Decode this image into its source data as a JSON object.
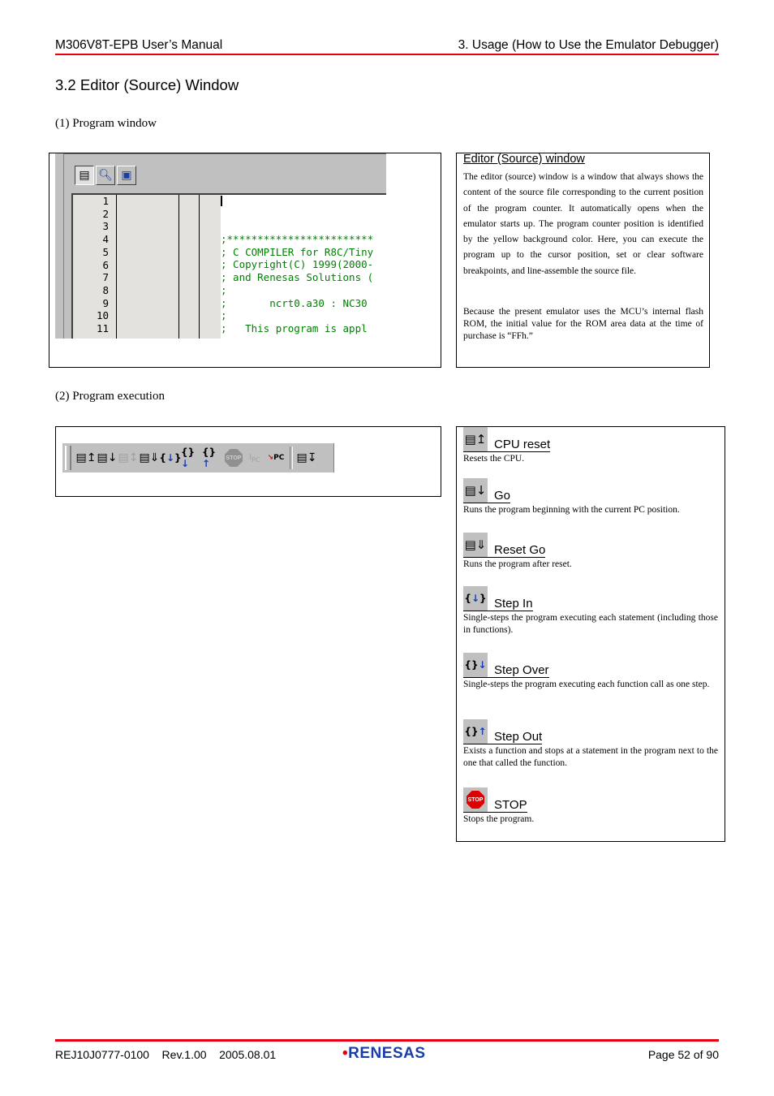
{
  "header": {
    "left": "M306V8T-EPB User’s Manual",
    "right": "3. Usage (How to Use the Emulator Debugger)"
  },
  "section_title": "3.2 Editor (Source) Window",
  "program_window": {
    "subtitle": "(1) Program window",
    "toolbar_icons": [
      "source-view-icon",
      "source-search-icon",
      "mixed-view-icon"
    ],
    "line_numbers": [
      "1",
      "2",
      "3",
      "4",
      "5",
      "6",
      "7",
      "8",
      "9",
      "10",
      "11"
    ],
    "source_lines": [
      ";************************",
      "; C COMPILER for R8C/Tiny",
      "; Copyright(C) 1999(2000-",
      "; and Renesas Solutions (",
      ";",
      ";       ncrt0.a30 : NC30",
      ";",
      ";   This program is appl",
      ";",
      ";************************",
      ""
    ],
    "source_color": "#008000"
  },
  "editor_description": {
    "title": "Editor (Source) window",
    "paragraph1": "The editor (source) window is a window that always shows the content of the source file corresponding to the current position of the program counter. It automatically opens when the emulator starts up. The program counter position is identified by the yellow background color. Here, you can execute the program up to the cursor position, set or clear software breakpoints, and line-assemble the source file.",
    "paragraph2": "Because the present emulator uses the MCU’s internal flash ROM, the initial value for the ROM area data at the time of purchase is “FFh.”"
  },
  "program_execution": {
    "subtitle": "(2) Program execution",
    "toolbar_buttons": [
      {
        "name": "cpu-reset",
        "glyph": "≣↥"
      },
      {
        "name": "go",
        "glyph": "≣↓"
      },
      {
        "name": "go-free",
        "glyph": "≣↕"
      },
      {
        "name": "reset-go",
        "glyph": "≣⇓"
      },
      {
        "name": "step-in",
        "glyph": "{↓}"
      },
      {
        "name": "step-over",
        "glyph": "{}↓"
      },
      {
        "name": "step-out",
        "glyph": "{}↑"
      },
      {
        "name": "stop",
        "glyph": "STOP"
      },
      {
        "name": "set-pc",
        "glyph": "I pc"
      },
      {
        "name": "show-pc",
        "glyph": "↘pc"
      },
      {
        "name": "come",
        "glyph": "≣↧"
      }
    ],
    "commands": [
      {
        "label": "CPU reset",
        "icon": "≣↥",
        "text": "Resets the CPU."
      },
      {
        "label": "Go",
        "icon": "≣↓",
        "text": "Runs the program beginning with the current PC position."
      },
      {
        "label": "Reset Go",
        "icon": "≣⇓",
        "text": "Runs the program after reset."
      },
      {
        "label": "Step In",
        "icon": "{↓}",
        "text": "Single-steps the program executing each statement (including those in functions)."
      },
      {
        "label": "Step Over",
        "icon": "{}↓",
        "text": "Single-steps the program executing each function call as one step."
      },
      {
        "label": "Step Out",
        "icon": "{}↑",
        "text": "Exists a function and stops at a statement in the program next to the one that called the function."
      },
      {
        "label": "STOP",
        "icon": "STOP",
        "text": "Stops the program."
      }
    ]
  },
  "footer": {
    "doc_id": "REJ10J0777-0100",
    "rev": "Rev.1.00",
    "date": "2005.08.01",
    "logo": "RENESAS",
    "page": "Page 52 of 90"
  },
  "colors": {
    "accent_red": "#e60012",
    "logo_blue": "#1a3ea8"
  }
}
